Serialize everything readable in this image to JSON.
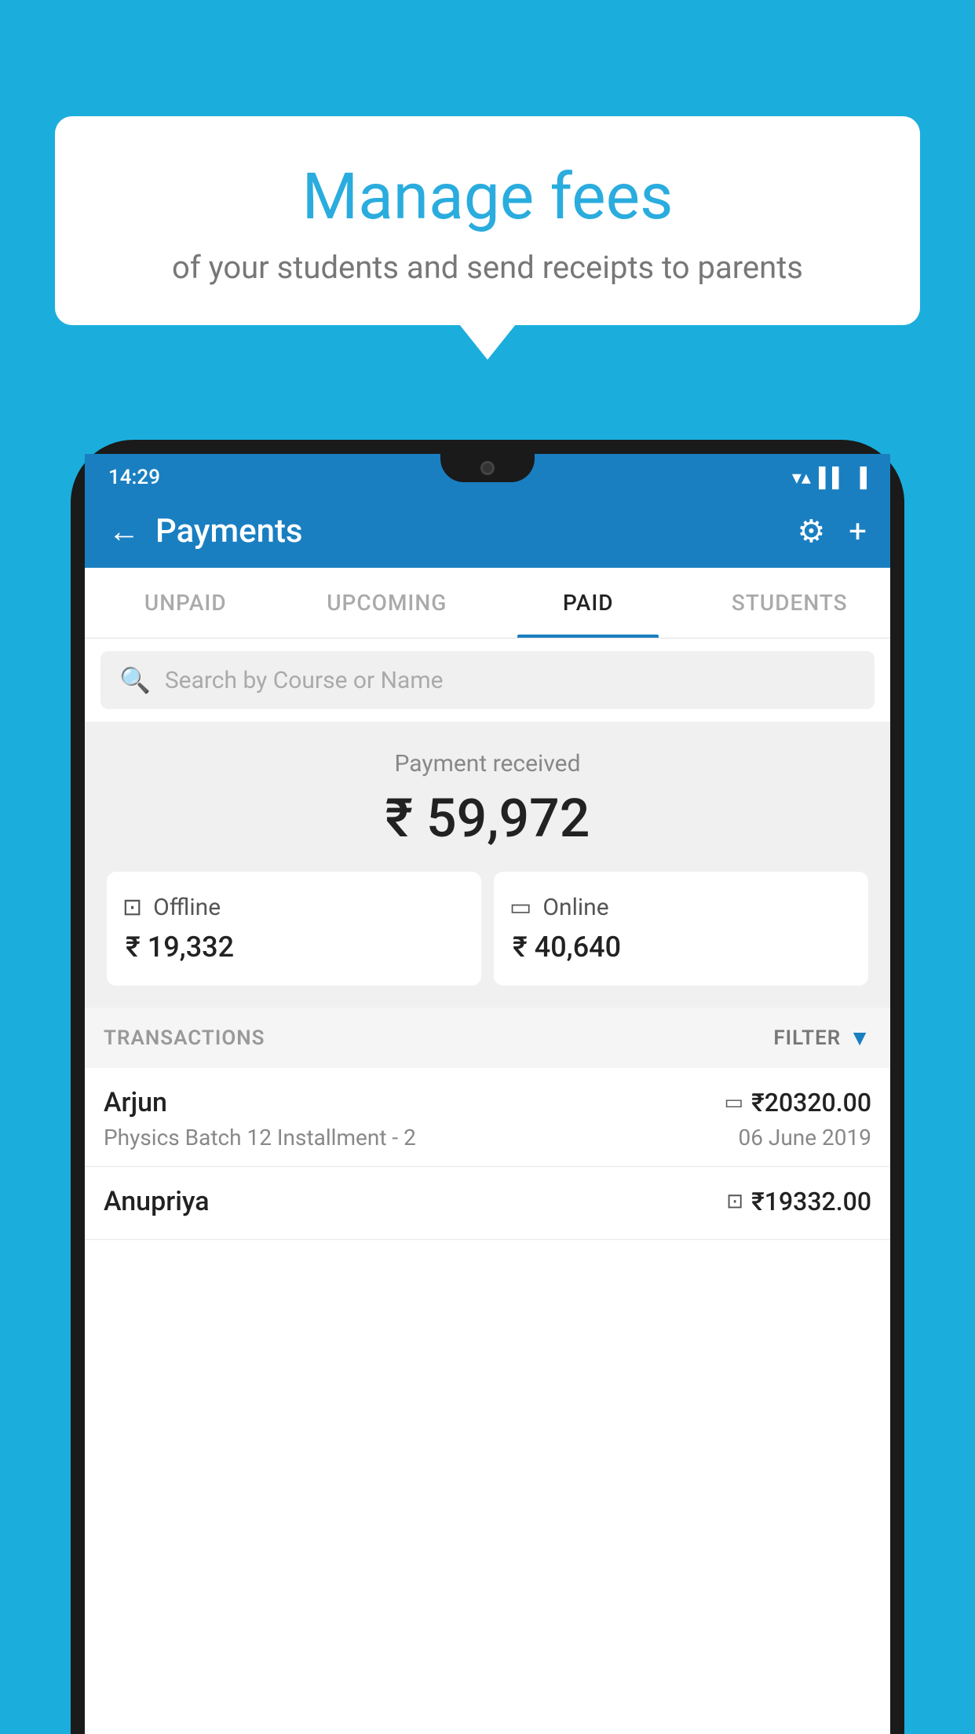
{
  "page": {
    "background_color": "#1BAEDC"
  },
  "speech_bubble": {
    "title": "Manage fees",
    "subtitle": "of your students and send receipts to parents"
  },
  "status_bar": {
    "time": "14:29",
    "wifi_icon": "wifi",
    "signal_icon": "signal",
    "battery_icon": "battery"
  },
  "app_header": {
    "title": "Payments",
    "back_label": "←",
    "settings_label": "⚙",
    "add_label": "+"
  },
  "tabs": [
    {
      "label": "UNPAID",
      "active": false
    },
    {
      "label": "UPCOMING",
      "active": false
    },
    {
      "label": "PAID",
      "active": true
    },
    {
      "label": "STUDENTS",
      "active": false
    }
  ],
  "search": {
    "placeholder": "Search by Course or Name"
  },
  "payment_summary": {
    "label": "Payment received",
    "total_amount": "₹ 59,972",
    "offline_label": "Offline",
    "offline_amount": "₹ 19,332",
    "online_label": "Online",
    "online_amount": "₹ 40,640"
  },
  "transactions": {
    "section_label": "TRANSACTIONS",
    "filter_label": "FILTER",
    "rows": [
      {
        "name": "Arjun",
        "course": "Physics Batch 12 Installment - 2",
        "amount": "₹20320.00",
        "date": "06 June 2019",
        "payment_mode": "online"
      },
      {
        "name": "Anupriya",
        "course": "",
        "amount": "₹19332.00",
        "date": "",
        "payment_mode": "offline"
      }
    ]
  }
}
